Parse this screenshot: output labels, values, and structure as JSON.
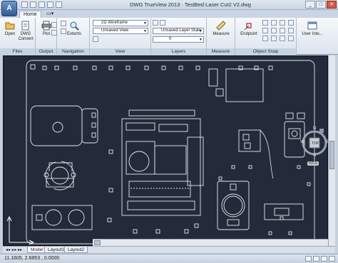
{
  "window": {
    "title": "DWG TrueView 2013 · TestBed Laser Cut2 V2.dwg",
    "app_button": "A"
  },
  "tabs": {
    "home": "Home"
  },
  "ribbon": {
    "files": {
      "label": "Files",
      "open": "Open",
      "dwg_convert_1": "DWG",
      "dwg_convert_2": "Convert"
    },
    "output": {
      "label": "Output",
      "plot": "Plot"
    },
    "navigation": {
      "label": "Navigation",
      "extents": "Extents"
    },
    "view": {
      "label": "View",
      "visual_style": "2D Wireframe",
      "named_view": "Unsaved View"
    },
    "layers": {
      "label": "Layers",
      "layer_state": "Unsaved Layer State",
      "layer_current": "0"
    },
    "measure": {
      "label": "Measure",
      "measure": "Measure"
    },
    "object_snap": {
      "label": "Object Snap",
      "endpoint": "Endpoint"
    },
    "user_interface": {
      "label": "User Inte..."
    }
  },
  "viewcube": {
    "top": "TOP",
    "n": "N",
    "s": "S",
    "w": "W",
    "e": "E",
    "wcs": "WCS"
  },
  "layout_tabs": [
    "Model",
    "Layout1",
    "Layout2"
  ],
  "status": {
    "coords": "11.1605, 2.6853 , 0.0000"
  }
}
